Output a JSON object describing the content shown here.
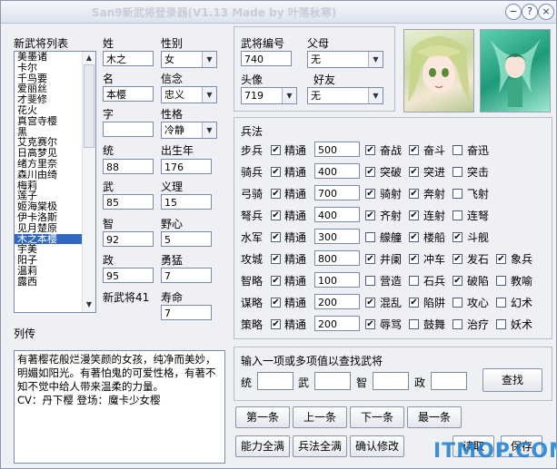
{
  "window": {
    "title": "San9新武将登录器(V1.13 Made by 叶落秋寒)"
  },
  "titlebar_buttons": [
    {
      "icon": "minimize-icon",
      "glyph": "−"
    },
    {
      "icon": "help-icon",
      "glyph": "?"
    },
    {
      "icon": "close-icon",
      "glyph": "×"
    }
  ],
  "list": {
    "label": "新武将列表",
    "items": [
      "美墨诸",
      "卡尔",
      "千鸟要",
      "爱丽丝",
      "才斐修",
      "花火",
      "真宫寺樱",
      "黑",
      "艾克赛尔",
      "日高梦见",
      "绪方里奈",
      "森川由绮",
      "梅莉",
      "莲子",
      "姬海棠极",
      "伊卡洛斯",
      "见月楚原",
      "木之本樱",
      "宇美",
      "阳子",
      "温莉",
      "露西"
    ],
    "selected_index": 17
  },
  "fields": {
    "xing_label": "姓",
    "xing_value": "木之",
    "xingbie_label": "性别",
    "xingbie_value": "女",
    "ming_label": "名",
    "ming_value": "本樱",
    "xinian_label": "信念",
    "xinian_value": "忠义",
    "zi_label": "字",
    "zi_value": "",
    "xingge_label": "性格",
    "xingge_value": "冷静",
    "tong_label": "统",
    "tong_value": "88",
    "birth_label": "出生年",
    "birth_value": "176",
    "wu_label": "武",
    "wu_value": "85",
    "yili_label": "义理",
    "yili_value": "15",
    "zhi_label": "智",
    "zhi_value": "92",
    "yexin_label": "野心",
    "yexin_value": "5",
    "zheng_label": "政",
    "zheng_value": "95",
    "yongmeng_label": "勇猛",
    "yongmeng_value": "7",
    "new_general_label": "新武将41",
    "shouming_label": "寿命",
    "shouming_value": "7"
  },
  "id_section": {
    "id_label": "武将编号",
    "id_value": "740",
    "parent_label": "父母",
    "parent_value": "无",
    "portrait_label": "头像",
    "portrait_value": "719",
    "friend_label": "好友",
    "friend_value": "无"
  },
  "bingfa": {
    "title": "兵法",
    "jingtong": "精通",
    "rows": [
      {
        "name": "步兵",
        "checked": true,
        "value": "500",
        "skills": [
          {
            "n": "奋战",
            "c": true
          },
          {
            "n": "奋斗",
            "c": true
          },
          {
            "n": "奋迅",
            "c": false
          }
        ]
      },
      {
        "name": "骑兵",
        "checked": true,
        "value": "400",
        "skills": [
          {
            "n": "突破",
            "c": true
          },
          {
            "n": "突进",
            "c": true
          },
          {
            "n": "突击",
            "c": false
          }
        ]
      },
      {
        "name": "弓骑",
        "checked": true,
        "value": "700",
        "skills": [
          {
            "n": "骑射",
            "c": true
          },
          {
            "n": "奔射",
            "c": true
          },
          {
            "n": "飞射",
            "c": false
          }
        ]
      },
      {
        "name": "弩兵",
        "checked": true,
        "value": "400",
        "skills": [
          {
            "n": "齐射",
            "c": true
          },
          {
            "n": "连射",
            "c": true
          },
          {
            "n": "连弩",
            "c": false
          }
        ]
      },
      {
        "name": "水军",
        "checked": true,
        "value": "300",
        "skills": [
          {
            "n": "艨艟",
            "c": false
          },
          {
            "n": "楼船",
            "c": true
          },
          {
            "n": "斗舰",
            "c": true
          }
        ]
      },
      {
        "name": "攻城",
        "checked": true,
        "value": "800",
        "skills": [
          {
            "n": "井阑",
            "c": true
          },
          {
            "n": "冲车",
            "c": true
          },
          {
            "n": "发石",
            "c": true
          },
          {
            "n": "象兵",
            "c": true
          }
        ]
      },
      {
        "name": "智略",
        "checked": true,
        "value": "100",
        "skills": [
          {
            "n": "营造",
            "c": false
          },
          {
            "n": "石兵",
            "c": false
          },
          {
            "n": "破陷",
            "c": true
          },
          {
            "n": "教喻",
            "c": false
          }
        ]
      },
      {
        "name": "谋略",
        "checked": true,
        "value": "200",
        "skills": [
          {
            "n": "混乱",
            "c": true
          },
          {
            "n": "陷阱",
            "c": true
          },
          {
            "n": "攻心",
            "c": false
          },
          {
            "n": "幻术",
            "c": false
          }
        ]
      },
      {
        "name": "策略",
        "checked": true,
        "value": "200",
        "skills": [
          {
            "n": "辱骂",
            "c": true
          },
          {
            "n": "鼓舞",
            "c": false
          },
          {
            "n": "治疗",
            "c": false
          },
          {
            "n": "妖术",
            "c": false
          }
        ]
      }
    ]
  },
  "liezhuan": {
    "label": "列传",
    "text": "有著樱花般烂漫笑颜的女孩，纯净而美妙，明媚如阳光。有著怕鬼的可爱性格，有著不知不觉中给人带来温柔的力量。\nCV：丹下樱 登场：魔卡少女樱"
  },
  "search": {
    "title": "输入一项或多项值以查找武将",
    "tong": "统",
    "wu": "武",
    "zhi": "智",
    "zheng": "政",
    "button": "查找"
  },
  "nav": {
    "first": "第一条",
    "prev": "上一条",
    "next": "下一条",
    "last": "最一条"
  },
  "actions": {
    "full_ability": "能力全满",
    "full_bingfa": "兵法全满",
    "confirm": "确认修改",
    "partial": "读取",
    "save": "保存"
  },
  "watermark": "ITMOP.COM"
}
